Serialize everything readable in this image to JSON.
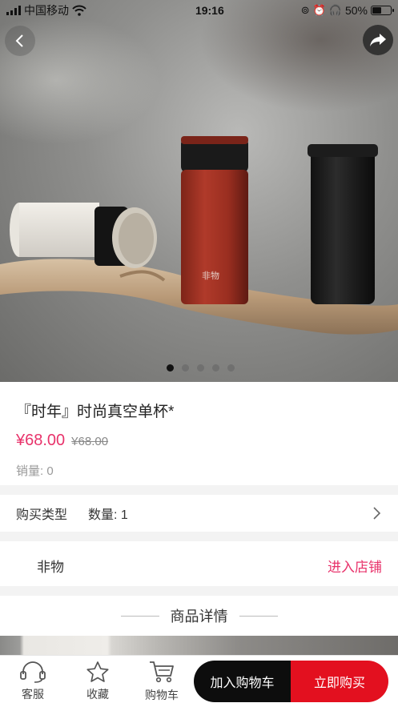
{
  "status_bar": {
    "carrier": "中国移动",
    "time": "19:16",
    "battery": "50%",
    "battery_level": 0.5
  },
  "gallery": {
    "image_count": 5,
    "active_index": 0,
    "bottle_brand_text": "非物"
  },
  "product": {
    "title": "『时年』时尚真空单杯*",
    "price": "¥68.00",
    "original_price": "¥68.00",
    "sales": "销量: 0"
  },
  "spec": {
    "type_label": "购买类型",
    "quantity": "数量: 1"
  },
  "store": {
    "name": "非物",
    "enter_label": "进入店铺"
  },
  "details": {
    "heading": "商品详情"
  },
  "bottom_bar": {
    "service": "客服",
    "favorite": "收藏",
    "cart": "购物车",
    "add_to_cart": "加入购物车",
    "buy_now": "立即购买"
  },
  "colors": {
    "accent": "#e8336b",
    "buy_button": "#e3101f",
    "cart_button": "#0d0d0d"
  }
}
